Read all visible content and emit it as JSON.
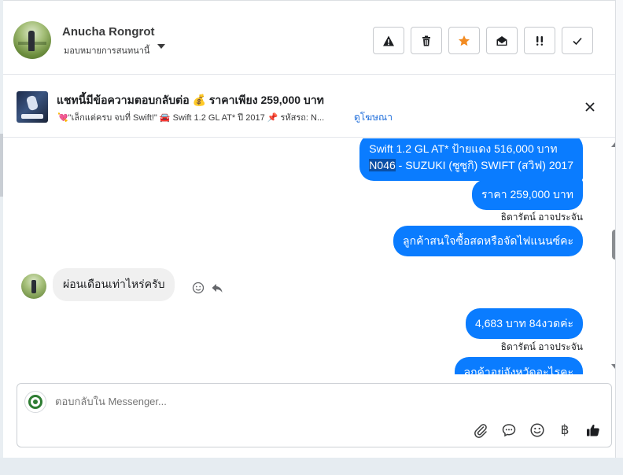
{
  "header": {
    "name": "Anucha Rongrot",
    "assign_label": "มอบหมายการสนทนานี้",
    "tools": [
      {
        "name": "report-icon",
        "icon": "warning-triangle"
      },
      {
        "name": "delete-icon",
        "icon": "trash"
      },
      {
        "name": "star-icon",
        "icon": "star",
        "color": "#f28b22"
      },
      {
        "name": "mark-unread-icon",
        "icon": "envelope-open"
      },
      {
        "name": "priority-icon",
        "icon": "double-exclamation"
      },
      {
        "name": "done-icon",
        "icon": "check"
      }
    ]
  },
  "ad": {
    "title": "แชทนี้มีข้อความตอบกลับต่อ 💰 ราคาเพียง 259,000 บาท",
    "subtitle": "💘\"เล็กแต่ครบ จบที่ Swift!\" 🚘 Swift 1.2 GL AT* ปี 2017 📌 รหัสรถ: N...",
    "link": "ดูโฆษณา"
  },
  "messages": {
    "m1_line1": "Swift 1.2 GL AT* ป้ายแดง 516,000 บาท",
    "m1_line2_hl": "N046",
    "m1_line2_rest": " - SUZUKI (ซูซูกิ) SWIFT (สวิฟ) 2017",
    "m2": "ราคา 259,000 บาท",
    "m2_sender": "ธิดารัตน์ อาจประจัน",
    "m3": "ลูกค้าสนใจซื้อสดหรือจัดไฟแนนซ์คะ",
    "m4_in": "ผ่อนเดือนเท่าไหร่ครับ",
    "m5": "4,683 บาท 84งวดค่ะ",
    "m5_sender": "ธิดารัตน์ อาจประจัน",
    "m6": "ลูกค้าอยู่จังหวัดอะไรคะ"
  },
  "composer": {
    "placeholder": "ตอบกลับใน Messenger...",
    "currency_symbol": "฿"
  },
  "colors": {
    "accent": "#0a7cff",
    "link": "#216fdb",
    "star": "#f28b22"
  }
}
